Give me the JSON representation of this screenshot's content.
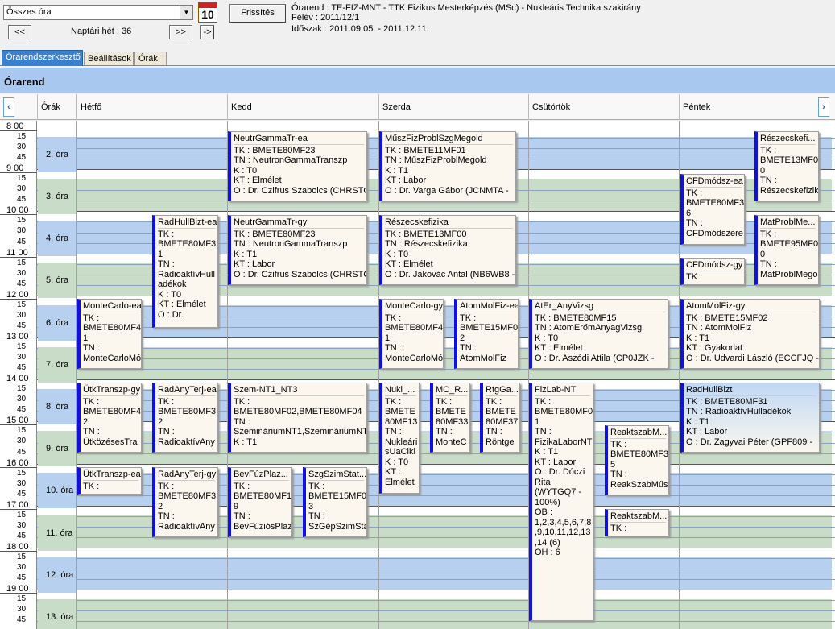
{
  "toolbar": {
    "combo_value": "Összes óra",
    "calendar_icon_day": "10",
    "prev_label": "<<",
    "next_label": ">>",
    "next2_label": "->",
    "week_label": "Naptári hét : 36",
    "refresh_label": "Frissítés"
  },
  "info": {
    "line1": "Órarend : TE-FIZ-MNT - TTK Fizikus Mesterképzés (MSc) - Nukleáris Technika szakirány",
    "line2": "Félév : 2011/12/1",
    "line3": "Időszak : 2011.09.05. - 2011.12.11."
  },
  "tabs": [
    "Órarendszerkesztő",
    "Beállítások",
    "Órák"
  ],
  "header": "Órarend",
  "columns": {
    "oras": "Órák",
    "days": [
      "Hétfő",
      "Kedd",
      "Szerda",
      "Csütörtök",
      "Péntek"
    ]
  },
  "hours": [
    "8 00",
    "9 00",
    "10 00",
    "11 00",
    "12 00",
    "13 00",
    "14 00",
    "15 00",
    "16 00",
    "17 00",
    "18 00",
    "19 00"
  ],
  "quarters": [
    "15",
    "30",
    "45"
  ],
  "ora_labels": [
    "2. óra",
    "3. óra",
    "4. óra",
    "5. óra",
    "6. óra",
    "7. óra",
    "8. óra",
    "9. óra",
    "10. óra",
    "11. óra",
    "12. óra",
    "13. óra"
  ],
  "events": [
    {
      "title": "NeutrGammaTr-ea",
      "lines": [
        "TK : BMETE80MF23",
        "TN : NeutronGammaTranszp",
        "K : T0",
        "KT : Elmélet",
        "O : Dr. Czifrus Szabolcs (CHRSTQ"
      ]
    },
    {
      "title": "MűszFizProblSzgMegold",
      "lines": [
        "TK : BMETE11MF01",
        "TN : MűszFizProblMegold",
        "K : T1",
        "KT : Labor",
        "O : Dr. Varga Gábor (JCNMTA -"
      ]
    },
    {
      "title": "Részecskefi...",
      "lines": [
        "TK :",
        "BMETE13MF0",
        "0",
        "TN :",
        "Részecskefizik"
      ]
    },
    {
      "title": "CFDmódsz-ea",
      "lines": [
        "TK :",
        "BMETE80MF3",
        "6",
        "TN :",
        "CFDmódszere"
      ]
    },
    {
      "title": "NeutrGammaTr-gy",
      "lines": [
        "TK : BMETE80MF23",
        "TN : NeutronGammaTranszp",
        "K : T1",
        "KT : Labor",
        "O : Dr. Czifrus Szabolcs (CHRSTQ"
      ]
    },
    {
      "title": "Részecskefizika",
      "lines": [
        "TK : BMETE13MF00",
        "TN : Részecskefizika",
        "K : T0",
        "KT : Elmélet",
        "O : Dr. Jakovác Antal (NB6WB8 -"
      ]
    },
    {
      "title": "RadHullBizt-ea",
      "lines": [
        "TK :",
        "BMETE80MF3",
        "1",
        "TN :",
        "RadioaktívHull",
        "adékok",
        "K : T0",
        "KT : Elmélet",
        "O : Dr."
      ]
    },
    {
      "title": "MatProblMe...",
      "lines": [
        "TK :",
        "BMETE95MF0",
        "0",
        "TN :",
        "MatProblMegol"
      ]
    },
    {
      "title": "CFDmódsz-gy",
      "lines": [
        "TK :"
      ]
    },
    {
      "title": "MonteCarlo-ea",
      "lines": [
        "TK :",
        "BMETE80MF4",
        "1",
        "TN :",
        "MonteCarloMó"
      ]
    },
    {
      "title": "MonteCarlo-gy",
      "lines": [
        "TK :",
        "BMETE80MF4",
        "1",
        "TN :",
        "MonteCarloMó"
      ]
    },
    {
      "title": "AtomMolFiz-ea",
      "lines": [
        "TK :",
        "BMETE15MF0",
        "2",
        "TN :",
        "AtomMolFiz"
      ]
    },
    {
      "title": "AtEr_AnyVizsg",
      "lines": [
        "TK : BMETE80MF15",
        "TN : AtomErőmAnyagVizsg",
        "K : T0",
        "KT : Elmélet",
        "O : Dr. Aszódi Attila (CP0JZK -"
      ]
    },
    {
      "title": "AtomMolFiz-gy",
      "lines": [
        "TK : BMETE15MF02",
        "TN : AtomMolFiz",
        "K : T1",
        "KT : Gyakorlat",
        "O : Dr. Udvardi László (ECCFJQ -"
      ]
    },
    {
      "title": "ÜtkTranszp-gy",
      "lines": [
        "TK :",
        "BMETE80MF4",
        "2",
        "TN :",
        "ÜtközésesTra"
      ]
    },
    {
      "title": "RadAnyTerj-ea",
      "lines": [
        "TK :",
        "BMETE80MF3",
        "2",
        "TN :",
        "RadioaktívAny"
      ]
    },
    {
      "title": "Szem-NT1_NT3",
      "lines": [
        "TK :",
        "BMETE80MF02,BMETE80MF04",
        "TN :",
        "SzemináriumNT1,SzemináriumNT3",
        "K : T1"
      ]
    },
    {
      "title": "Nukl_...",
      "lines": [
        "TK :",
        "BMETE",
        "80MF13",
        "TN :",
        "Nukleári",
        "sUaCikl",
        "K : T0",
        "KT :",
        "Elmélet"
      ]
    },
    {
      "title": "MC_R...",
      "lines": [
        "TK :",
        "BMETE",
        "80MF33",
        "TN :",
        "MonteC"
      ]
    },
    {
      "title": "RtgGa...",
      "lines": [
        "TK :",
        "BMETE",
        "80MF37",
        "TN :",
        "Röntge"
      ]
    },
    {
      "title": "FizLab-NT",
      "lines": [
        "TK :",
        "BMETE80MF0",
        "1",
        "TN :",
        "FizikaLaborNT",
        "K : T1",
        "KT : Labor",
        "O : Dr. Dóczi",
        "Rita",
        "(WYTGQ7 -",
        "100%)",
        "OB :",
        "1,2,3,4,5,6,7,8",
        ",9,10,11,12,13",
        ",14 (6)",
        "OH : 6"
      ]
    },
    {
      "title": "RadHullBizt",
      "lines": [
        "TK : BMETE80MF31",
        "TN : RadioaktívHulladékok",
        "K : T1",
        "KT : Labor",
        "O : Dr. Zagyvai Péter (GPF809 -"
      ]
    },
    {
      "title": "ReaktszabM...",
      "lines": [
        "TK :",
        "BMETE80MF3",
        "5",
        "TN :",
        "ReakSzabMűs"
      ]
    },
    {
      "title": "ÜtkTranszp-ea",
      "lines": [
        "TK :"
      ]
    },
    {
      "title": "RadAnyTerj-gy",
      "lines": [
        "TK :",
        "BMETE80MF3",
        "2",
        "TN :",
        "RadioaktívAny"
      ]
    },
    {
      "title": "BevFúzPlaz...",
      "lines": [
        "TK :",
        "BMETE80MF1",
        "9",
        "TN :",
        "BevFúziósPlaz"
      ]
    },
    {
      "title": "SzgSzimStat...",
      "lines": [
        "TK :",
        "BMETE15MF0",
        "3",
        "TN :",
        "SzGépSzimSta"
      ]
    },
    {
      "title": "ReaktszabM...",
      "lines": [
        "TK :"
      ]
    }
  ]
}
